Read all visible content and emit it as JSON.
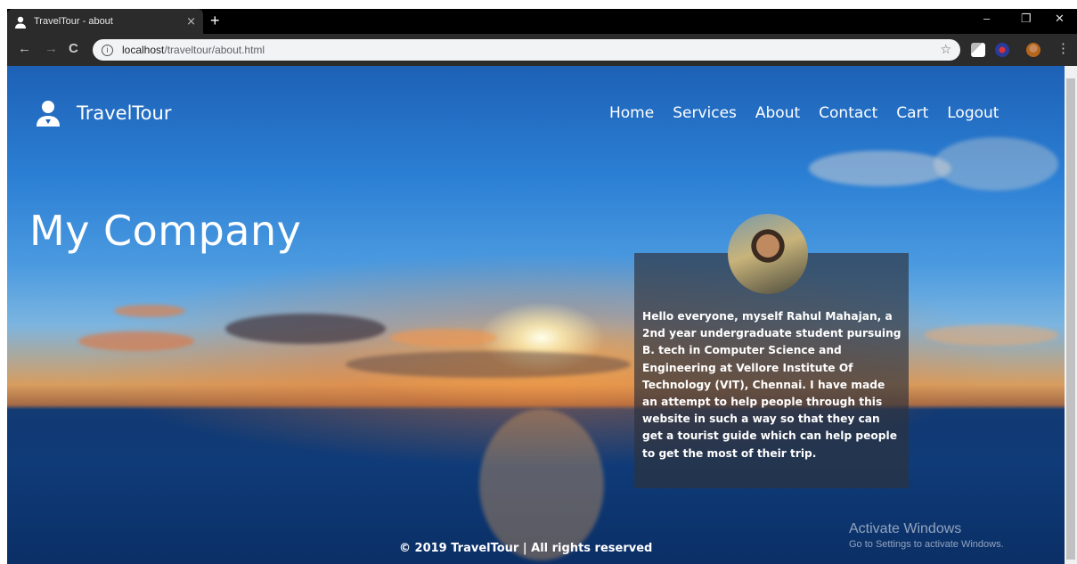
{
  "browser": {
    "tab_title": "TravelTour - about",
    "tab_close": "×",
    "new_tab": "+",
    "url_host": "localhost",
    "url_path": "/traveltour/about.html",
    "info_icon": "i",
    "bookmark_icon": "☆",
    "back_icon": "←",
    "forward_icon": "→",
    "reload_icon": "C",
    "menu_icon": "⋮",
    "minimize_icon": "–",
    "restore_icon": "❐",
    "close_icon": "✕"
  },
  "site": {
    "brand": "TravelTour",
    "nav": [
      "Home",
      "Services",
      "About",
      "Contact",
      "Cart",
      "Logout"
    ],
    "heading": "My Company",
    "about_text": "Hello everyone, myself Rahul Mahajan, a 2nd year undergraduate student pursuing B. tech in Computer Science and Engineering at Vellore Institute Of Technology (VIT), Chennai. I have made an attempt to help people through this website in such a way so that they can get a tourist guide which can help people to get the most of their trip.",
    "footer": "© 2019 TravelTour | All rights reserved"
  },
  "os": {
    "watermark_title": "Activate Windows",
    "watermark_sub": "Go to Settings to activate Windows."
  },
  "colors": {
    "tab_bar": "#000000",
    "toolbar": "#2b2b2b",
    "card_overlay": "rgba(45,50,60,0.68)"
  }
}
